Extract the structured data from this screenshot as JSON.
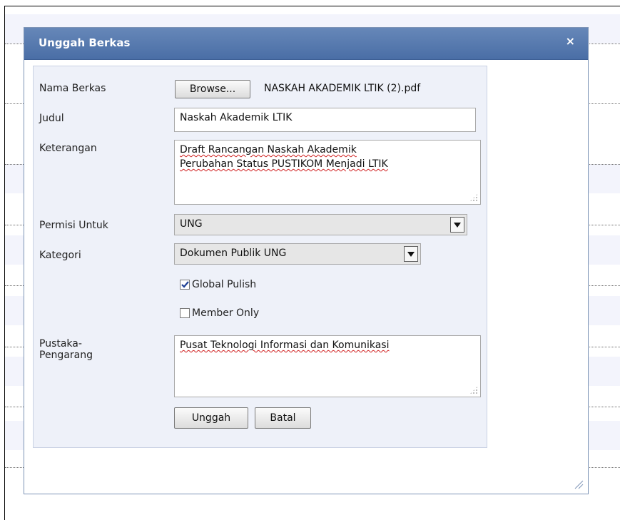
{
  "dialog": {
    "title": "Unggah Berkas",
    "close_glyph": "×"
  },
  "form": {
    "file": {
      "label": "Nama Berkas",
      "browse_label": "Browse...",
      "filename": "NASKAH AKADEMIK LTIK (2).pdf"
    },
    "title": {
      "label": "Judul",
      "value": "Naskah Akademik LTIK"
    },
    "description": {
      "label": "Keterangan",
      "line1": "Draft Rancangan Naskah Akademik",
      "line2": "Perubahan Status PUSTIKOM Menjadi LTIK"
    },
    "permission": {
      "label": "Permisi Untuk",
      "selected": "UNG"
    },
    "category": {
      "label": "Kategori",
      "selected": "Dokumen Publik UNG"
    },
    "global_publish": {
      "label": "Global Pulish",
      "checked": true
    },
    "member_only": {
      "label": "Member Only",
      "checked": false
    },
    "author": {
      "label_line1": "Pustaka-",
      "label_line2": "Pengarang",
      "value": "Pusat Teknologi Informasi dan Komunikasi"
    },
    "actions": {
      "upload_label": "Unggah",
      "cancel_label": "Batal"
    }
  },
  "icons": {
    "dropdown": "chevron-down-icon",
    "close": "close-icon",
    "checkmark": "checkmark-icon",
    "resize": "resize-grip-icon"
  },
  "colors": {
    "titlebar": "#5177b0",
    "panel": "#eef1f9",
    "row_band": "#f3f4fc"
  }
}
